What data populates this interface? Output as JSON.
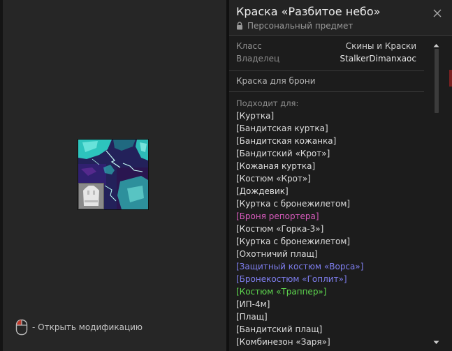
{
  "preview": {
    "hint_text": "- Открыть модификацию"
  },
  "item": {
    "title": "Краска «Разбитое небо»",
    "subtitle": "Персональный предмет",
    "props": [
      {
        "key": "Класс",
        "value": "Скины и Краски"
      },
      {
        "key": "Владелец",
        "value": "StalkerDimanxaoc"
      }
    ],
    "category": "Краска для брони",
    "fits_label": "Подходит для:",
    "fits": [
      {
        "label": "[Куртка]",
        "color": "default"
      },
      {
        "label": "[Бандитская куртка]",
        "color": "default"
      },
      {
        "label": "[Бандитская кожанка]",
        "color": "default"
      },
      {
        "label": "[Бандитский «Крот»]",
        "color": "default"
      },
      {
        "label": "[Кожаная куртка]",
        "color": "default"
      },
      {
        "label": "[Костюм «Крот»]",
        "color": "default"
      },
      {
        "label": "[Дождевик]",
        "color": "default"
      },
      {
        "label": "[Куртка с бронежилетом]",
        "color": "default"
      },
      {
        "label": "[Броня репортера]",
        "color": "pink"
      },
      {
        "label": "[Костюм «Горка-3»]",
        "color": "default"
      },
      {
        "label": "[Куртка с бронежилетом]",
        "color": "default"
      },
      {
        "label": "[Охотничий плащ]",
        "color": "default"
      },
      {
        "label": "[Защитный костюм «Ворса»]",
        "color": "blue"
      },
      {
        "label": "[Бронекостюм «Гоплит»]",
        "color": "blue"
      },
      {
        "label": "[Костюм «Траппер»]",
        "color": "green"
      },
      {
        "label": "[ИП-4м]",
        "color": "default"
      },
      {
        "label": "[Плащ]",
        "color": "default"
      },
      {
        "label": "[Бандитский плащ]",
        "color": "default"
      },
      {
        "label": "[Комбинезон «Заря»]",
        "color": "default"
      }
    ]
  },
  "colors": {
    "rarity_pink": "#d85bbd",
    "rarity_blue": "#7f7ff0",
    "rarity_green": "#5fd94f",
    "paint_cyan": "#2fd6c8",
    "paint_purple": "#3b1f73"
  },
  "icons": {
    "close": "close-icon",
    "lock": "lock-icon",
    "mouse": "mouse-icon",
    "item_preview": "paint-swatch-image",
    "armor_badge": "armor-silhouette-icon"
  }
}
